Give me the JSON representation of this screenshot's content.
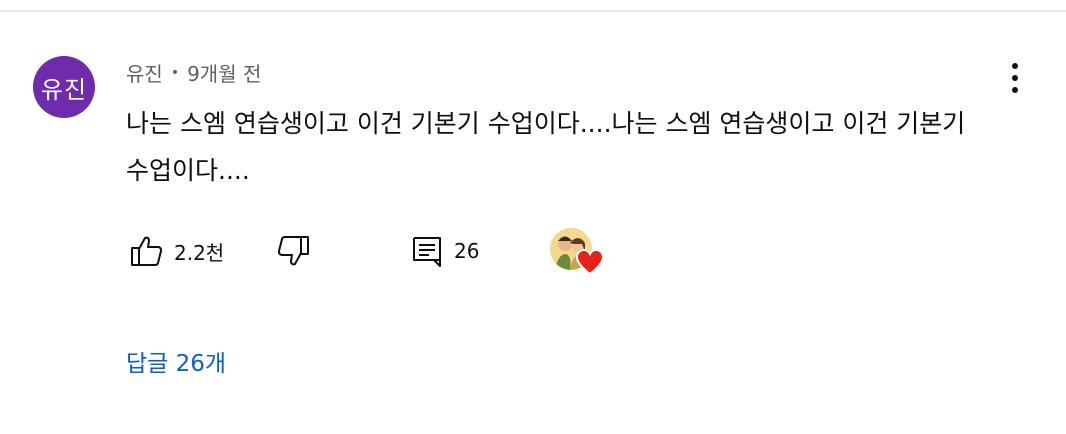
{
  "comment": {
    "avatar_text": "유진",
    "author": "유진",
    "separator": "•",
    "timestamp": "9개월 전",
    "text": "나는 스엠 연습생이고 이건 기본기 수업이다....나는 스엠 연습생이고 이건 기본기 수업이다....",
    "like_count": "2.2천",
    "reply_count": "26",
    "replies_link": "답글 26개"
  },
  "colors": {
    "avatar_bg": "#6e2cad",
    "link": "#065fd4",
    "meta_text": "#606060",
    "heart": "#e62117"
  },
  "icons": {
    "like": "thumbs-up-icon",
    "dislike": "thumbs-down-icon",
    "reply": "comment-icon",
    "more": "vertical-ellipsis-icon",
    "creator_heart": "heart-icon"
  }
}
